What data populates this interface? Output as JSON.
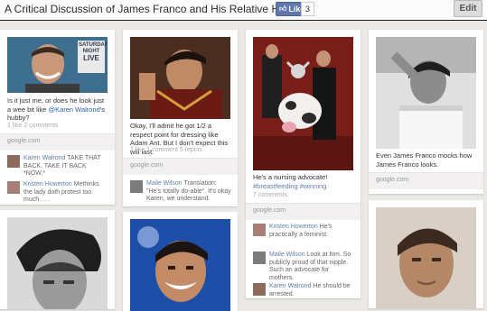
{
  "header": {
    "title": "A Critical Discussion of James Franco and His Relative Hotness",
    "like_label": "Like",
    "like_count": "3",
    "edit_label": "Edit"
  },
  "pins": {
    "p1": {
      "text_before": "Is it just me, or does he look just a wee bit like ",
      "mention": "@Karen Walrond",
      "text_after": "'s hubby?",
      "stats": "1 like  2 comments",
      "source": "google.com",
      "overlay_line1": "SATURDAY",
      "overlay_line2": "NIGHT",
      "overlay_line3": "LIVE",
      "comments": [
        {
          "author": "Karen Walrond",
          "text": " TAKE THAT BACK. TAKE IT BACK *NOW.*"
        },
        {
          "author": "Kristen Howerton",
          "text": " Methinks the lady doth protest too much . . ."
        }
      ]
    },
    "p2": {
      "text": "Okay, I'll admit he got 1/2 a respect point for dressing like Adam Ant. But I don't expect this will last.",
      "stats": "1 like  1 comment  5 repins",
      "source": "google.com",
      "comments": [
        {
          "author": "Maile Wilson",
          "text": " Translation: \"He's totally do-able\". It's okay Karen, we understand."
        }
      ]
    },
    "p3": {
      "text": "He's a nursing advocate!",
      "tag1": "#breastfeeding",
      "tag2": "#winning",
      "stats": "7 comments",
      "source": "google.com",
      "comments": [
        {
          "author": "Kristen Howerton",
          "text": " He's practically a feminist."
        },
        {
          "author": "Maile Wilson",
          "text": " Look at him. So publicly proud of that nipple. Such an advocate for mothers."
        },
        {
          "author": "Karen Walrond",
          "text": " He should be arrested."
        }
      ]
    },
    "p4": {
      "text": "Even James Franco mocks how James Franco looks.",
      "source": "google.com"
    }
  },
  "colors": {
    "link": "#2d63a6",
    "author": "#5f7fa8",
    "facebook": "#5f78ab"
  }
}
